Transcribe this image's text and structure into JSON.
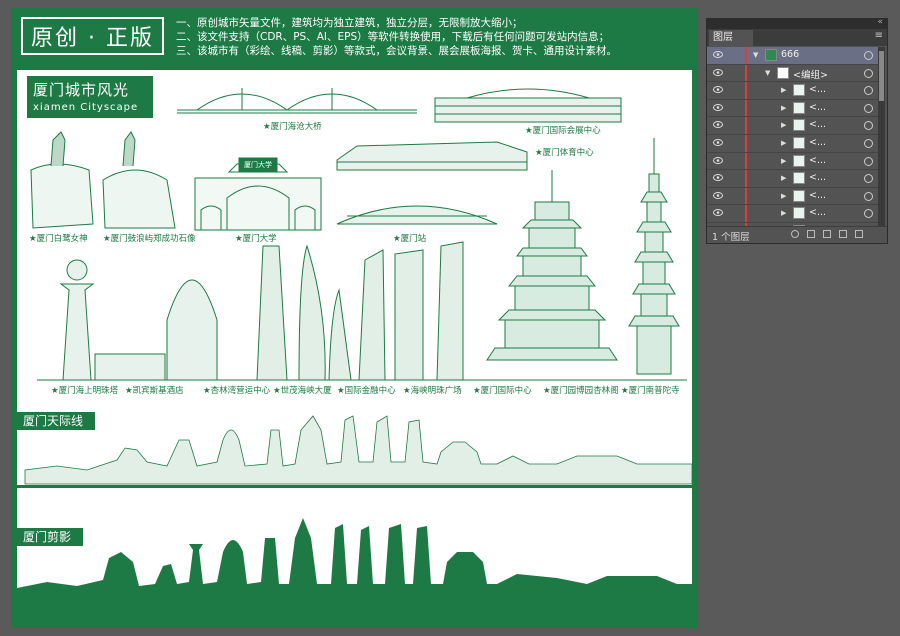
{
  "header": {
    "badge": "原创 · 正版",
    "notes": [
      "一、原创城市矢量文件，建筑均为独立建筑，独立分层，无限制放大缩小；",
      "二、该文件支持（CDR、PS、AI、EPS）等软件转换使用，下载后有任何问题可发站内信息；",
      "三、该城市有（彩绘、线稿、剪影）等款式，会议背景、展会展板海报、贺卡、通用设计素材。"
    ]
  },
  "section1": {
    "title": "厦门城市风光",
    "subtitle": "xiamen Cityscape"
  },
  "captions": [
    "★厦门海沧大桥",
    "★厦门国际会展中心",
    "★厦门体育中心",
    "★厦门白鹭女神",
    "★厦门鼓浪屿郑成功石像",
    "★厦门大学",
    "★厦门站",
    "★厦门海上明珠塔",
    "★凯宾斯基酒店",
    "★杏林湾营运中心",
    "★世茂海峡大厦",
    "★国际金融中心",
    "★海峡明珠广场",
    "★厦门国际中心",
    "★厦门园博园杏林阁",
    "★厦门南普陀寺"
  ],
  "gate_plaque": "厦门大学",
  "section2": {
    "title": "厦门天际线"
  },
  "section3": {
    "title": "厦门剪影"
  },
  "layers_panel": {
    "tab": "图层",
    "rows": [
      {
        "name": "666"
      },
      {
        "name": "<编组>"
      },
      {
        "name": "<..."
      },
      {
        "name": "<..."
      },
      {
        "name": "<..."
      },
      {
        "name": "<..."
      },
      {
        "name": "<..."
      },
      {
        "name": "<..."
      },
      {
        "name": "<..."
      },
      {
        "name": "<..."
      },
      {
        "name": "<..."
      }
    ],
    "count": "1 个图层"
  },
  "colors": {
    "brand_green": "#1e7a45",
    "canvas_bg": "#5a5a5a",
    "layer_bar": "#d9403a"
  }
}
